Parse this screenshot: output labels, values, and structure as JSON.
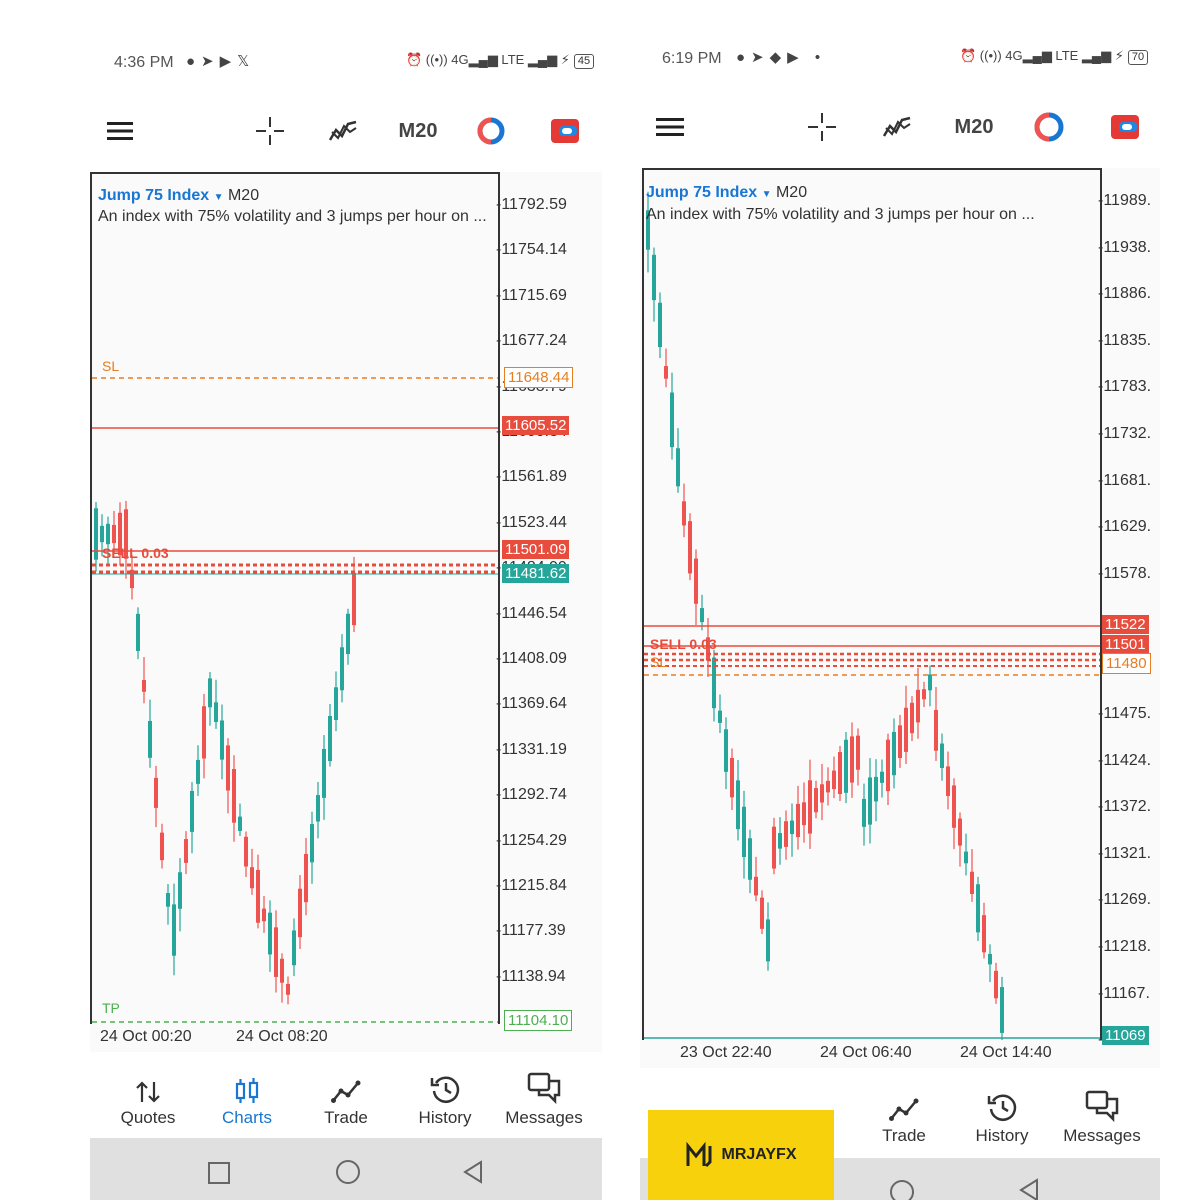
{
  "left": {
    "status": {
      "time": "4:36 PM",
      "battery": "45"
    },
    "toolbar": {
      "timeframe": "M20"
    },
    "chart": {
      "symbol": "Jump 75 Index",
      "timeframe": "M20",
      "description": "An index with 75% volatility and 3 jumps per hour on ...",
      "price_axis": [
        "11792.59",
        "11754.14",
        "11715.69",
        "11677.24",
        "11638.79",
        "11600.34",
        "11561.89",
        "11523.44",
        "11484.99",
        "11446.54",
        "11408.09",
        "11369.64",
        "11331.19",
        "11292.74",
        "11254.29",
        "11215.84",
        "11177.39",
        "11138.94"
      ],
      "sl_label": "SL",
      "sl_price": "11648.44",
      "red_price_1": "11605.52",
      "red_price_2": "11501.09",
      "bid_price": "11481.62",
      "tp_label": "TP",
      "tp_price": "11104.10",
      "sell_label": "SELL 0.03",
      "time_axis": [
        "24 Oct 00:20",
        "24 Oct 08:20"
      ]
    },
    "nav": {
      "quotes": "Quotes",
      "charts": "Charts",
      "trade": "Trade",
      "history": "History",
      "messages": "Messages"
    }
  },
  "right": {
    "status": {
      "time": "6:19 PM",
      "battery": "70"
    },
    "toolbar": {
      "timeframe": "M20"
    },
    "chart": {
      "symbol": "Jump 75 Index",
      "timeframe": "M20",
      "description": "An index with 75% volatility and 3 jumps per hour on ...",
      "price_axis": [
        "11989.",
        "11938.",
        "11886.",
        "11835.",
        "11783.",
        "11732.",
        "11681.",
        "11629.",
        "11578.",
        "11475.",
        "11424.",
        "11372.",
        "11321.",
        "11269.",
        "11218.",
        "11167.",
        "11115."
      ],
      "red_price_1": "11522",
      "red_price_2": "11501",
      "sl_price": "11480",
      "bid_price": "11069",
      "sell_label": "SELL 0.03",
      "sl_label": "SL",
      "time_axis": [
        "23 Oct 22:40",
        "24 Oct 06:40",
        "24 Oct 14:40"
      ]
    },
    "nav": {
      "trade": "Trade",
      "history": "History",
      "messages": "Messages"
    }
  },
  "watermark": {
    "text": "MRJAYFX"
  },
  "colors": {
    "bull": "#26a69a",
    "bear": "#ef5350",
    "sl": "#e67e22",
    "tp": "#4caf50",
    "accent": "#1976d2"
  }
}
